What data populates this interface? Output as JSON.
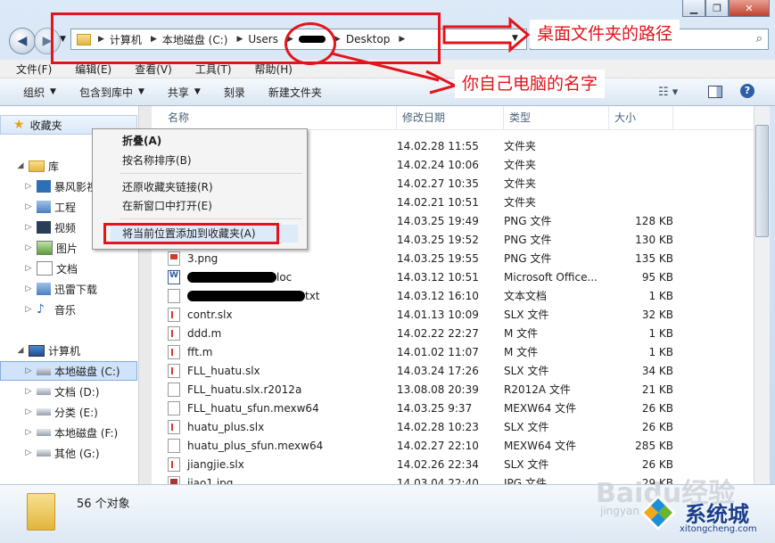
{
  "address": {
    "crumbs": [
      "计算机",
      "本地磁盘 (C:)",
      "Users",
      "Desktop"
    ]
  },
  "menu": [
    "文件(F)",
    "编辑(E)",
    "查看(V)",
    "工具(T)",
    "帮助(H)"
  ],
  "toolbar": {
    "organize": "组织",
    "include_library": "包含到库中",
    "share": "共享",
    "burn": "刻录",
    "new_folder": "新建文件夹"
  },
  "nav": {
    "favorites": "收藏夹",
    "library": "库",
    "lib_items": [
      "暴风影视",
      "工程",
      "视频",
      "图片",
      "文档",
      "迅雷下载",
      "音乐"
    ],
    "computer": "计算机",
    "drives": [
      "本地磁盘 (C:)",
      "文档 (D:)",
      "分类 (E:)",
      "本地磁盘 (F:)",
      "其他 (G:)"
    ]
  },
  "columns": {
    "name": "名称",
    "date": "修改日期",
    "type": "类型",
    "size": "大小"
  },
  "files": [
    {
      "name": "",
      "icon": "folder",
      "date": "14.02.28 11:55",
      "type": "文件夹",
      "size": ""
    },
    {
      "name": "",
      "icon": "folder",
      "date": "14.02.24 10:06",
      "type": "文件夹",
      "size": ""
    },
    {
      "name": "",
      "icon": "folder",
      "date": "14.02.27 10:35",
      "type": "文件夹",
      "size": ""
    },
    {
      "name": "",
      "icon": "folder",
      "date": "14.02.21 10:51",
      "type": "文件夹",
      "size": ""
    },
    {
      "name": "",
      "icon": "png",
      "date": "14.03.25 19:49",
      "type": "PNG 文件",
      "size": "128 KB"
    },
    {
      "name": "",
      "icon": "png",
      "date": "14.03.25 19:52",
      "type": "PNG 文件",
      "size": "130 KB"
    },
    {
      "name": "3.png",
      "icon": "png",
      "date": "14.03.25 19:55",
      "type": "PNG 文件",
      "size": "135 KB"
    },
    {
      "name": "loc",
      "icon": "doc",
      "date": "14.03.12 10:51",
      "type": "Microsoft Office...",
      "size": "95 KB"
    },
    {
      "name": "txt",
      "icon": "txt",
      "date": "14.03.12 16:10",
      "type": "文本文档",
      "size": "1 KB"
    },
    {
      "name": "contr.slx",
      "icon": "m",
      "date": "14.01.13 10:09",
      "type": "SLX 文件",
      "size": "32 KB"
    },
    {
      "name": "ddd.m",
      "icon": "m",
      "date": "14.02.22 22:27",
      "type": "M 文件",
      "size": "1 KB"
    },
    {
      "name": "fft.m",
      "icon": "m",
      "date": "14.01.02 11:07",
      "type": "M 文件",
      "size": "1 KB"
    },
    {
      "name": "FLL_huatu.slx",
      "icon": "m",
      "date": "14.03.24 17:26",
      "type": "SLX 文件",
      "size": "34 KB"
    },
    {
      "name": "FLL_huatu.slx.r2012a",
      "icon": "txt",
      "date": "13.08.08 20:39",
      "type": "R2012A 文件",
      "size": "21 KB"
    },
    {
      "name": "FLL_huatu_sfun.mexw64",
      "icon": "txt",
      "date": "14.03.25 9:37",
      "type": "MEXW64 文件",
      "size": "26 KB"
    },
    {
      "name": "huatu_plus.slx",
      "icon": "m",
      "date": "14.02.28 10:23",
      "type": "SLX 文件",
      "size": "26 KB"
    },
    {
      "name": "huatu_plus_sfun.mexw64",
      "icon": "txt",
      "date": "14.02.27 22:10",
      "type": "MEXW64 文件",
      "size": "285 KB"
    },
    {
      "name": "jiangjie.slx",
      "icon": "m",
      "date": "14.02.26 22:34",
      "type": "SLX 文件",
      "size": "26 KB"
    },
    {
      "name": "jiao1.jpg",
      "icon": "jpg",
      "date": "14.03.04 22:40",
      "type": "JPG 文件",
      "size": "29 KB"
    }
  ],
  "context_menu": {
    "collapse": "折叠(A)",
    "sort_by_name": "按名称排序(B)",
    "restore_links": "还原收藏夹链接(R)",
    "open_new_window": "在新窗口中打开(E)",
    "add_to_favorites": "将当前位置添加到收藏夹(A)"
  },
  "status": {
    "count": "56 个对象"
  },
  "annotations": {
    "path_note": "桌面文件夹的路径",
    "name_note": "你自己电脑的名字",
    "red": "#e3141b"
  },
  "watermark": {
    "baidu": "Baidu经验",
    "jingyan": "jingyan",
    "brand": "系统城",
    "site": "xitongcheng.com"
  }
}
